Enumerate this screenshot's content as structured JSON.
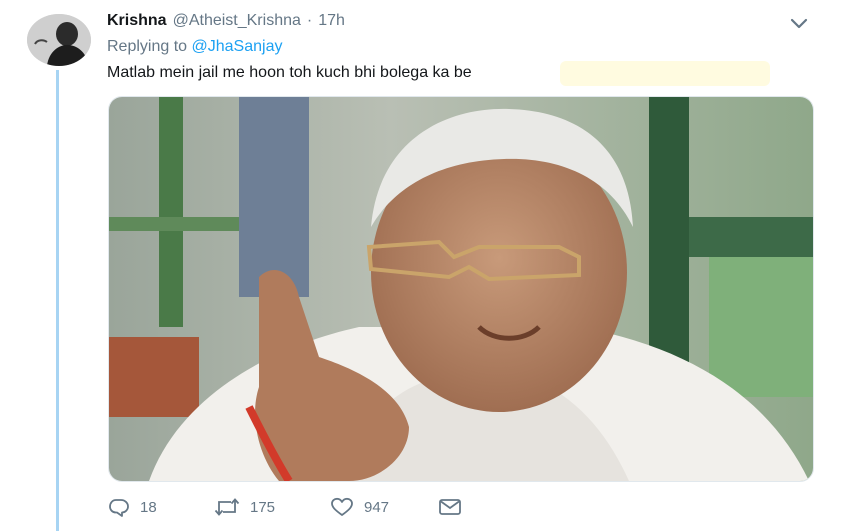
{
  "tweet": {
    "display_name": "Krishna",
    "handle": "@Atheist_Krishna",
    "separator": "·",
    "time": "17h",
    "replying_label": "Replying to",
    "replying_to": "@JhaSanjay",
    "text": "Matlab mein jail me hoon toh kuch bhi bolega ka be"
  },
  "actions": {
    "reply_icon": "reply-icon",
    "reply_count": "18",
    "retweet_icon": "retweet-icon",
    "retweet_count": "175",
    "like_icon": "heart-icon",
    "like_count": "947",
    "message_icon": "envelope-icon"
  },
  "colors": {
    "accent": "#1da1f2",
    "secondary_text": "#657786",
    "thread_line": "#a7d4f3",
    "highlight": "#fffbe0"
  }
}
